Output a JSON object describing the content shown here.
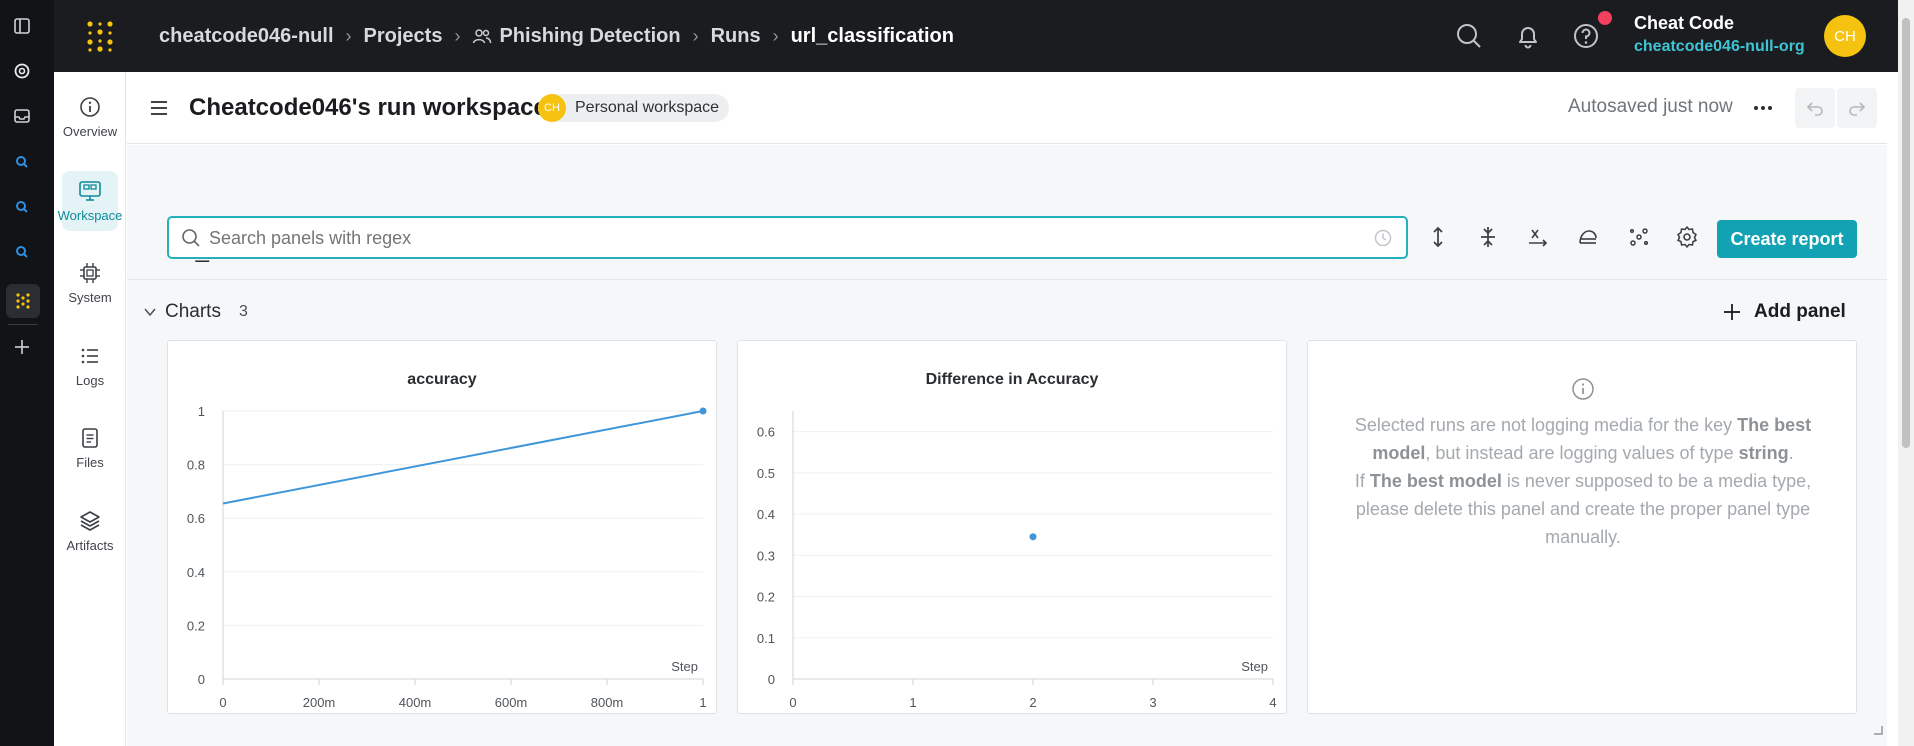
{
  "topbar": {
    "breadcrumbs": [
      "cheatcode046-null",
      "Projects",
      "Phishing Detection",
      "Runs",
      "url_classification"
    ],
    "user_name": "Cheat Code",
    "user_org": "cheatcode046-null-org",
    "user_initials": "CH"
  },
  "leftnav": {
    "items": [
      {
        "label": "Overview",
        "icon": "info-icon"
      },
      {
        "label": "Workspace",
        "icon": "workspace-icon"
      },
      {
        "label": "System",
        "icon": "chip-icon"
      },
      {
        "label": "Logs",
        "icon": "list-icon"
      },
      {
        "label": "Files",
        "icon": "file-icon"
      },
      {
        "label": "Artifacts",
        "icon": "layers-icon"
      }
    ]
  },
  "workspace": {
    "title": "Cheatcode046's run workspace",
    "badge_initials": "CH",
    "badge_label": "Personal workspace",
    "autosave": "Autosaved just now"
  },
  "run": {
    "name": "url_classification",
    "search_placeholder": "Search panels with regex",
    "create_report": "Create report"
  },
  "section": {
    "label": "Charts",
    "count": "3",
    "add_panel": "Add panel"
  },
  "colors": {
    "accent": "#13a2b4",
    "line": "#3f97d9",
    "topbar": "#1a1c1f"
  },
  "chart_data": [
    {
      "type": "line",
      "title": "accuracy",
      "xlabel": "Step",
      "ylabel": "",
      "x": [
        0,
        1
      ],
      "y": [
        0.655,
        1.0
      ],
      "xlim": [
        0,
        1
      ],
      "ylim": [
        0,
        1
      ],
      "xticks": [
        "0",
        "200m",
        "400m",
        "600m",
        "800m",
        "1"
      ],
      "yticks": [
        "0",
        "0.2",
        "0.4",
        "0.6",
        "0.8",
        "1"
      ],
      "grid": true
    },
    {
      "type": "scatter",
      "title": "Difference in Accuracy",
      "xlabel": "Step",
      "ylabel": "",
      "x": [
        2
      ],
      "y": [
        0.345
      ],
      "xlim": [
        0,
        4
      ],
      "ylim": [
        0,
        0.65
      ],
      "xticks": [
        "0",
        "1",
        "2",
        "3",
        "4"
      ],
      "yticks": [
        "0",
        "0.1",
        "0.2",
        "0.3",
        "0.4",
        "0.5",
        "0.6"
      ],
      "grid": true
    }
  ],
  "media_panel": {
    "line1_pre": "Selected runs are not logging media for the key ",
    "key": "The best model",
    "line1_post": ", but instead are logging values of type ",
    "type": "string",
    "line2_pre": "If ",
    "line2_post": " is never supposed to be a media type, please delete this panel and create the proper panel type manually."
  }
}
